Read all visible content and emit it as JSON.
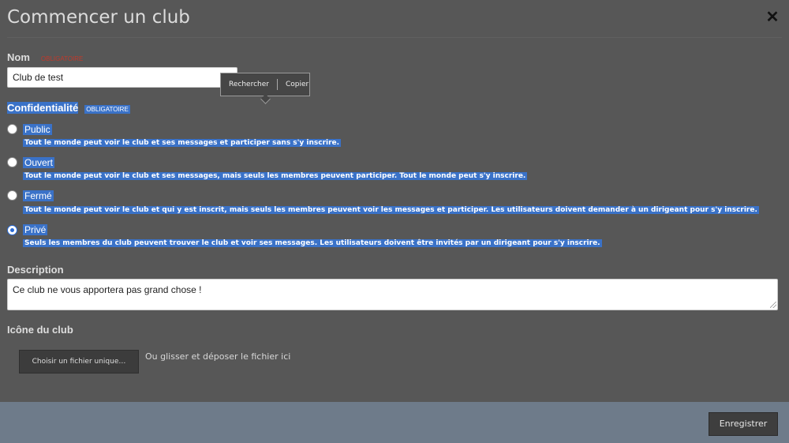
{
  "header": {
    "title": "Commencer un club",
    "close_icon": "close-icon"
  },
  "name_field": {
    "label": "Nom",
    "required_label": "Obligatoire",
    "value": "Club de test"
  },
  "context_popup": {
    "search_label": "Rechercher",
    "copy_label": "Copier"
  },
  "privacy": {
    "label": "Confidentialité",
    "required_label": "Obligatoire",
    "selected": "Privé",
    "options": [
      {
        "label": "Public",
        "description": "Tout le monde peut voir le club et ses messages et participer sans s'y inscrire."
      },
      {
        "label": "Ouvert",
        "description": "Tout le monde peut voir le club et ses messages, mais seuls les membres peuvent participer. Tout le monde peut s'y inscrire."
      },
      {
        "label": "Fermé",
        "description": "Tout le monde peut voir le club et qui y est inscrit, mais seuls les membres peuvent voir les messages et participer. Les utilisateurs doivent demander à un dirigeant pour s'y inscrire."
      },
      {
        "label": "Privé",
        "description": "Seuls les membres du club peuvent trouver le club et voir ses messages. Les utilisateurs doivent être invités par un dirigeant pour s'y inscrire."
      }
    ]
  },
  "description_field": {
    "label": "Description",
    "value": "Ce club ne vous apportera pas grand chose !"
  },
  "icon_field": {
    "label": "Icône du club",
    "button_label": "Choisir un fichier unique…",
    "drop_hint": "Ou glisser et déposer le fichier ici"
  },
  "footer": {
    "save_label": "Enregistrer"
  },
  "colors": {
    "selection": "#3a72c8",
    "background": "#575757",
    "footer": "#6e7b8a",
    "required": "#c0392b"
  }
}
